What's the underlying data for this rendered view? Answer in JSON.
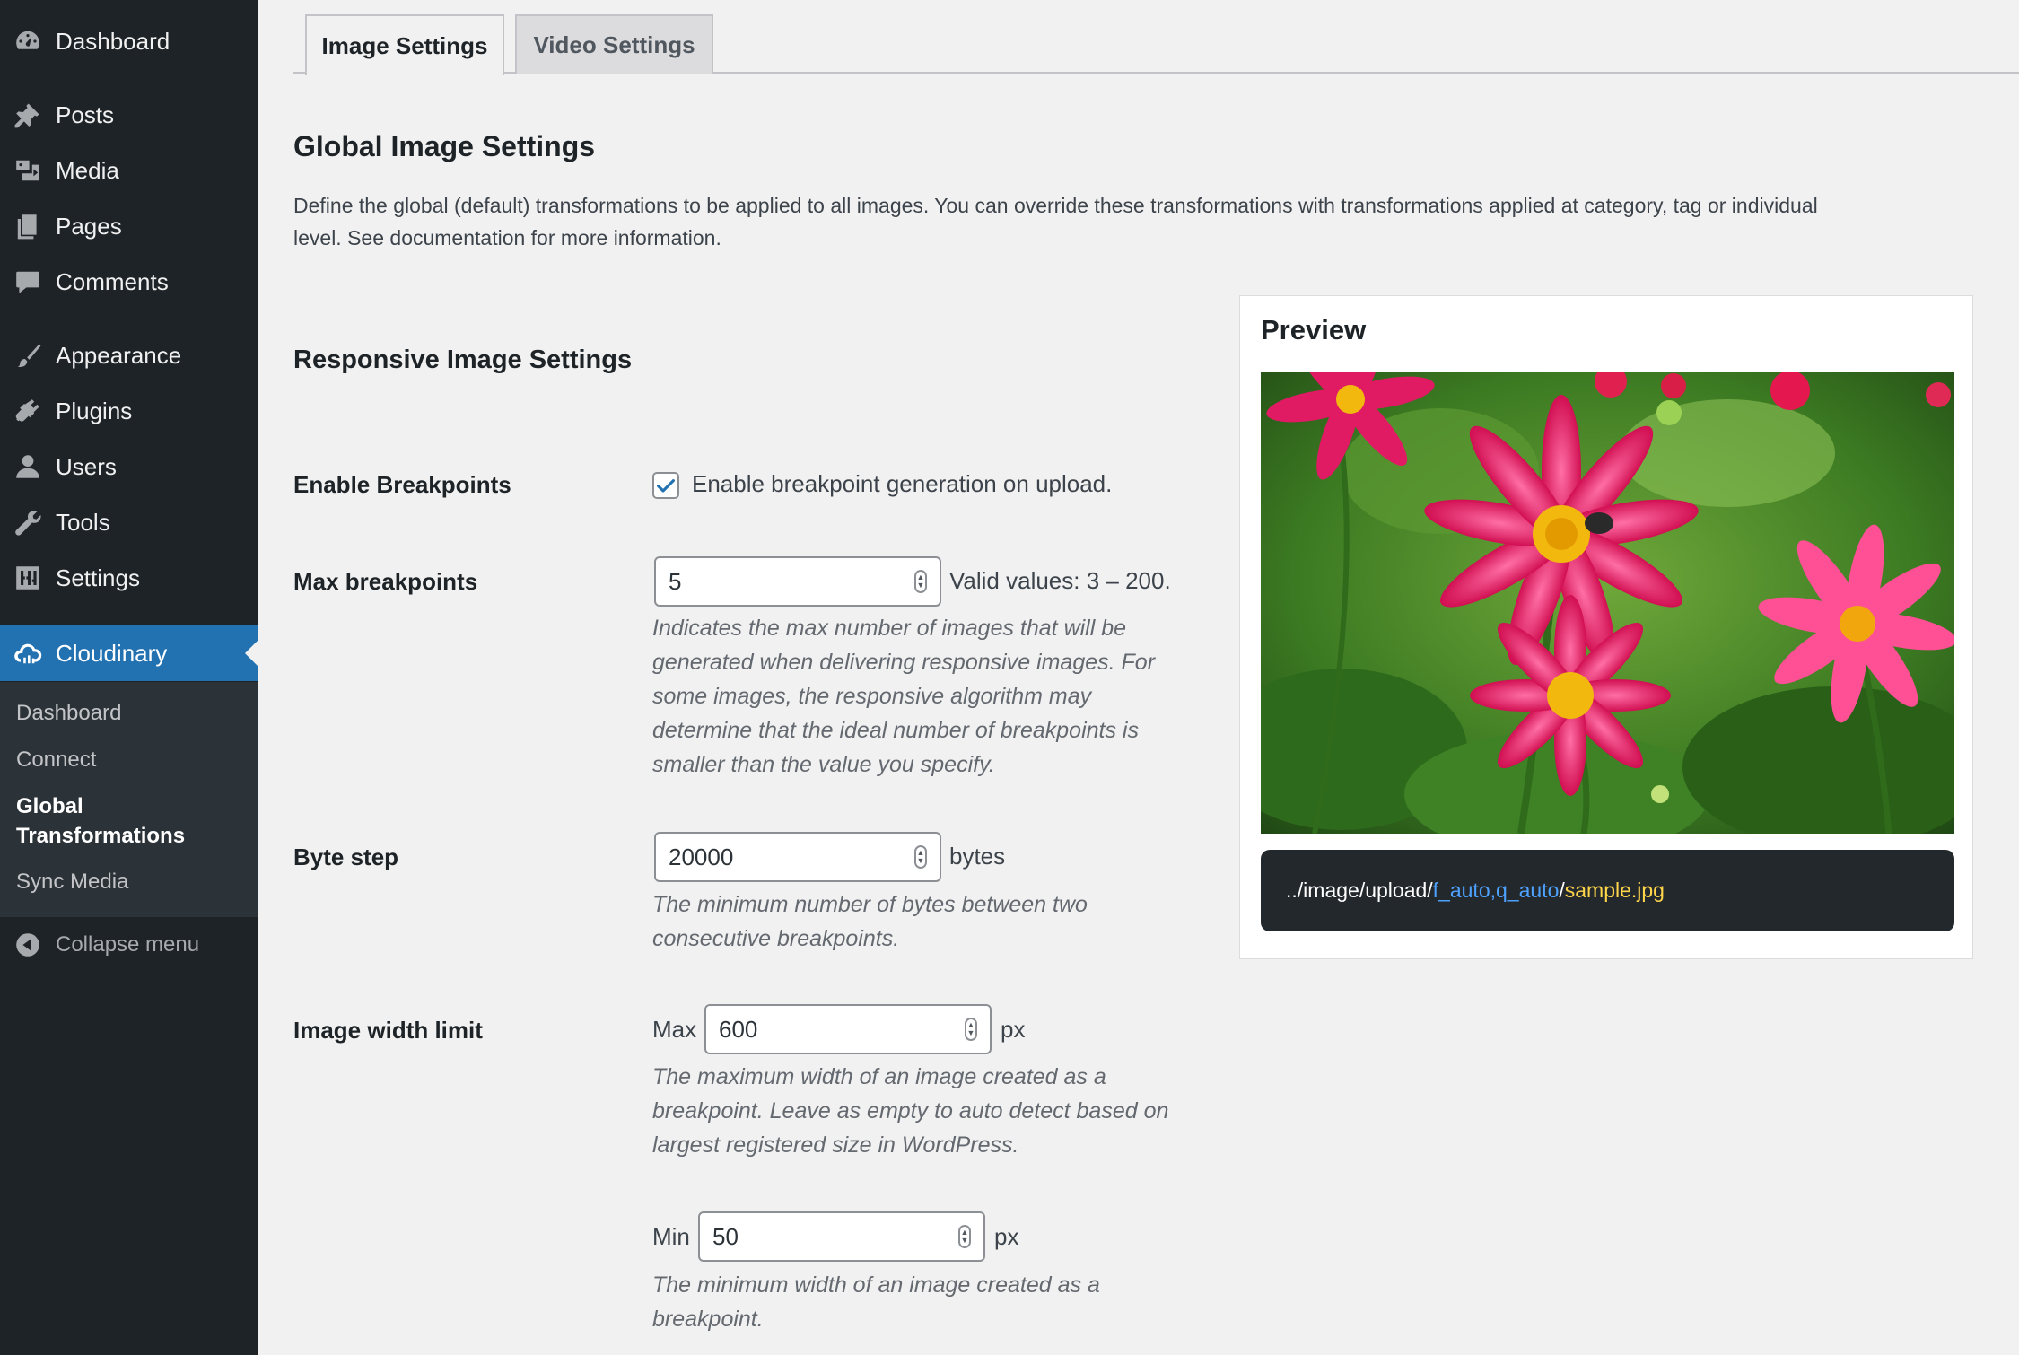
{
  "sidebar": {
    "items": [
      {
        "label": "Dashboard",
        "icon": "dashboard-icon"
      },
      {
        "label": "Posts",
        "icon": "pin-icon"
      },
      {
        "label": "Media",
        "icon": "media-icon"
      },
      {
        "label": "Pages",
        "icon": "pages-icon"
      },
      {
        "label": "Comments",
        "icon": "comment-icon"
      },
      {
        "label": "Appearance",
        "icon": "brush-icon"
      },
      {
        "label": "Plugins",
        "icon": "plug-icon"
      },
      {
        "label": "Users",
        "icon": "user-icon"
      },
      {
        "label": "Tools",
        "icon": "wrench-icon"
      },
      {
        "label": "Settings",
        "icon": "sliders-icon"
      },
      {
        "label": "Cloudinary",
        "icon": "cloud-icon"
      }
    ],
    "submenu": [
      {
        "label": "Dashboard"
      },
      {
        "label": "Connect"
      },
      {
        "label_line1": "Global",
        "label_line2": "Transformations"
      },
      {
        "label": "Sync Media"
      }
    ],
    "collapse_label": "Collapse menu"
  },
  "tabs": [
    {
      "label": "Image Settings",
      "active": true
    },
    {
      "label": "Video Settings",
      "active": false
    }
  ],
  "main": {
    "heading": "Global Image Settings",
    "description_line1": "Define the global (default) transformations to be applied to all images. You can override these transformations with transformations applied at category, tag or individual",
    "description_line2": "level. See documentation for more information.",
    "responsive_heading": "Responsive Image Settings",
    "enable_breakpoints": {
      "label": "Enable Breakpoints",
      "checked": true,
      "checkbox_text": "Enable breakpoint generation on upload."
    },
    "max_breakpoints": {
      "label": "Max breakpoints",
      "value": "5",
      "suffix": "Valid values: 3 – 200.",
      "help": [
        "Indicates the max number of images that will be",
        "generated when delivering responsive images. For",
        "some images, the responsive algorithm may",
        "determine that the ideal number of breakpoints is",
        "smaller than the value you specify."
      ]
    },
    "byte_step": {
      "label": "Byte step",
      "value": "20000",
      "suffix": "bytes",
      "help": [
        "The minimum number of bytes between two",
        "consecutive breakpoints."
      ]
    },
    "image_width_limit": {
      "label": "Image width limit",
      "max_prefix": "Max",
      "max_value": "600",
      "max_suffix": "px",
      "max_help": [
        "The maximum width of an image created as a",
        "breakpoint. Leave as empty to auto detect based on",
        "largest registered size in WordPress."
      ],
      "min_prefix": "Min",
      "min_value": "50",
      "min_suffix": "px",
      "min_help": [
        "The minimum width of an image created as a",
        "breakpoint."
      ]
    }
  },
  "preview": {
    "title": "Preview",
    "url_base": "../image/upload/",
    "url_transform": "f_auto,q_auto",
    "url_sep": "/",
    "url_file": "sample.jpg"
  },
  "colors": {
    "sidebar_bg": "#1d2327",
    "accent": "#2271b1",
    "url_transform": "#4ea2ff",
    "url_file": "#ffd54a"
  }
}
